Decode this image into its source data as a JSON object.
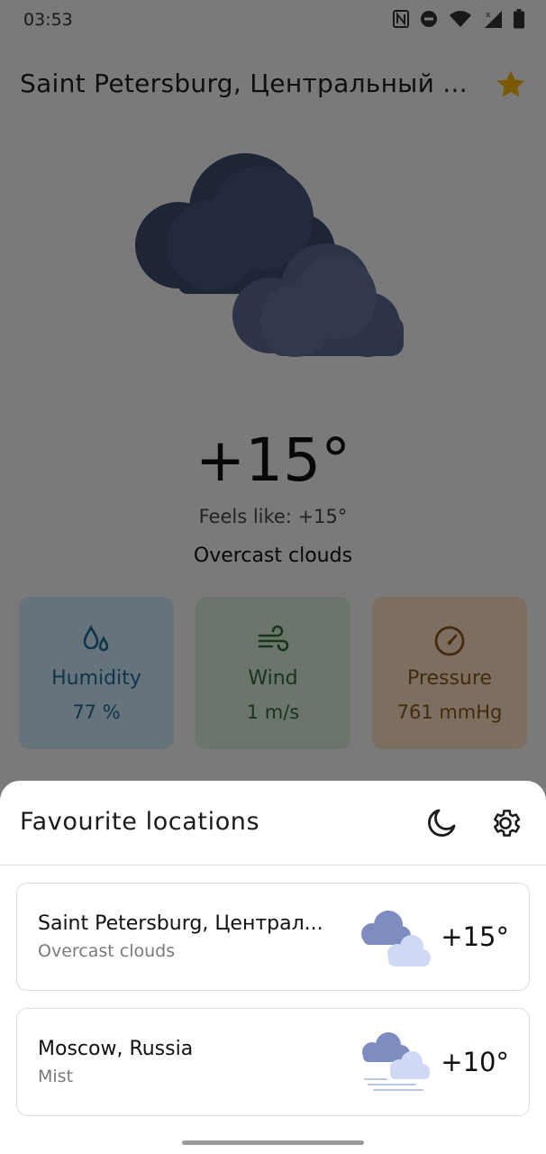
{
  "status_bar": {
    "time": "03:53",
    "icons": [
      "nfc-icon",
      "dnd-icon",
      "wifi-icon",
      "signal-icon",
      "battery-icon"
    ]
  },
  "header": {
    "city": "Saint Petersburg, Центральный ...",
    "favourite_icon": "star-icon",
    "favourite_color": "#f2b400"
  },
  "current": {
    "icon": "overcast-clouds-icon",
    "temperature": "+15°",
    "feels_like": "Feels like: +15°",
    "description": "Overcast clouds"
  },
  "cards": {
    "humidity": {
      "icon": "humidity-icon",
      "label": "Humidity",
      "value": "77 %",
      "color": "#1d6a9c",
      "bg": "#cfe7f5"
    },
    "wind": {
      "icon": "wind-icon",
      "label": "Wind",
      "value": "1 m/s",
      "color": "#2f6b36",
      "bg": "#d6ebd8"
    },
    "pressure": {
      "icon": "pressure-gauge-icon",
      "label": "Pressure",
      "value": "761 mmHg",
      "color": "#8a5517",
      "bg": "#f9dfc4"
    }
  },
  "sheet": {
    "title": "Favourite locations",
    "theme_icon": "moon-icon",
    "settings_icon": "gear-icon",
    "locations": [
      {
        "name": "Saint Petersburg, Централ...",
        "description": "Overcast clouds",
        "icon": "overcast-clouds-icon",
        "temperature": "+15°"
      },
      {
        "name": "Moscow, Russia",
        "description": "Mist",
        "icon": "mist-icon",
        "temperature": "+10°"
      }
    ]
  }
}
